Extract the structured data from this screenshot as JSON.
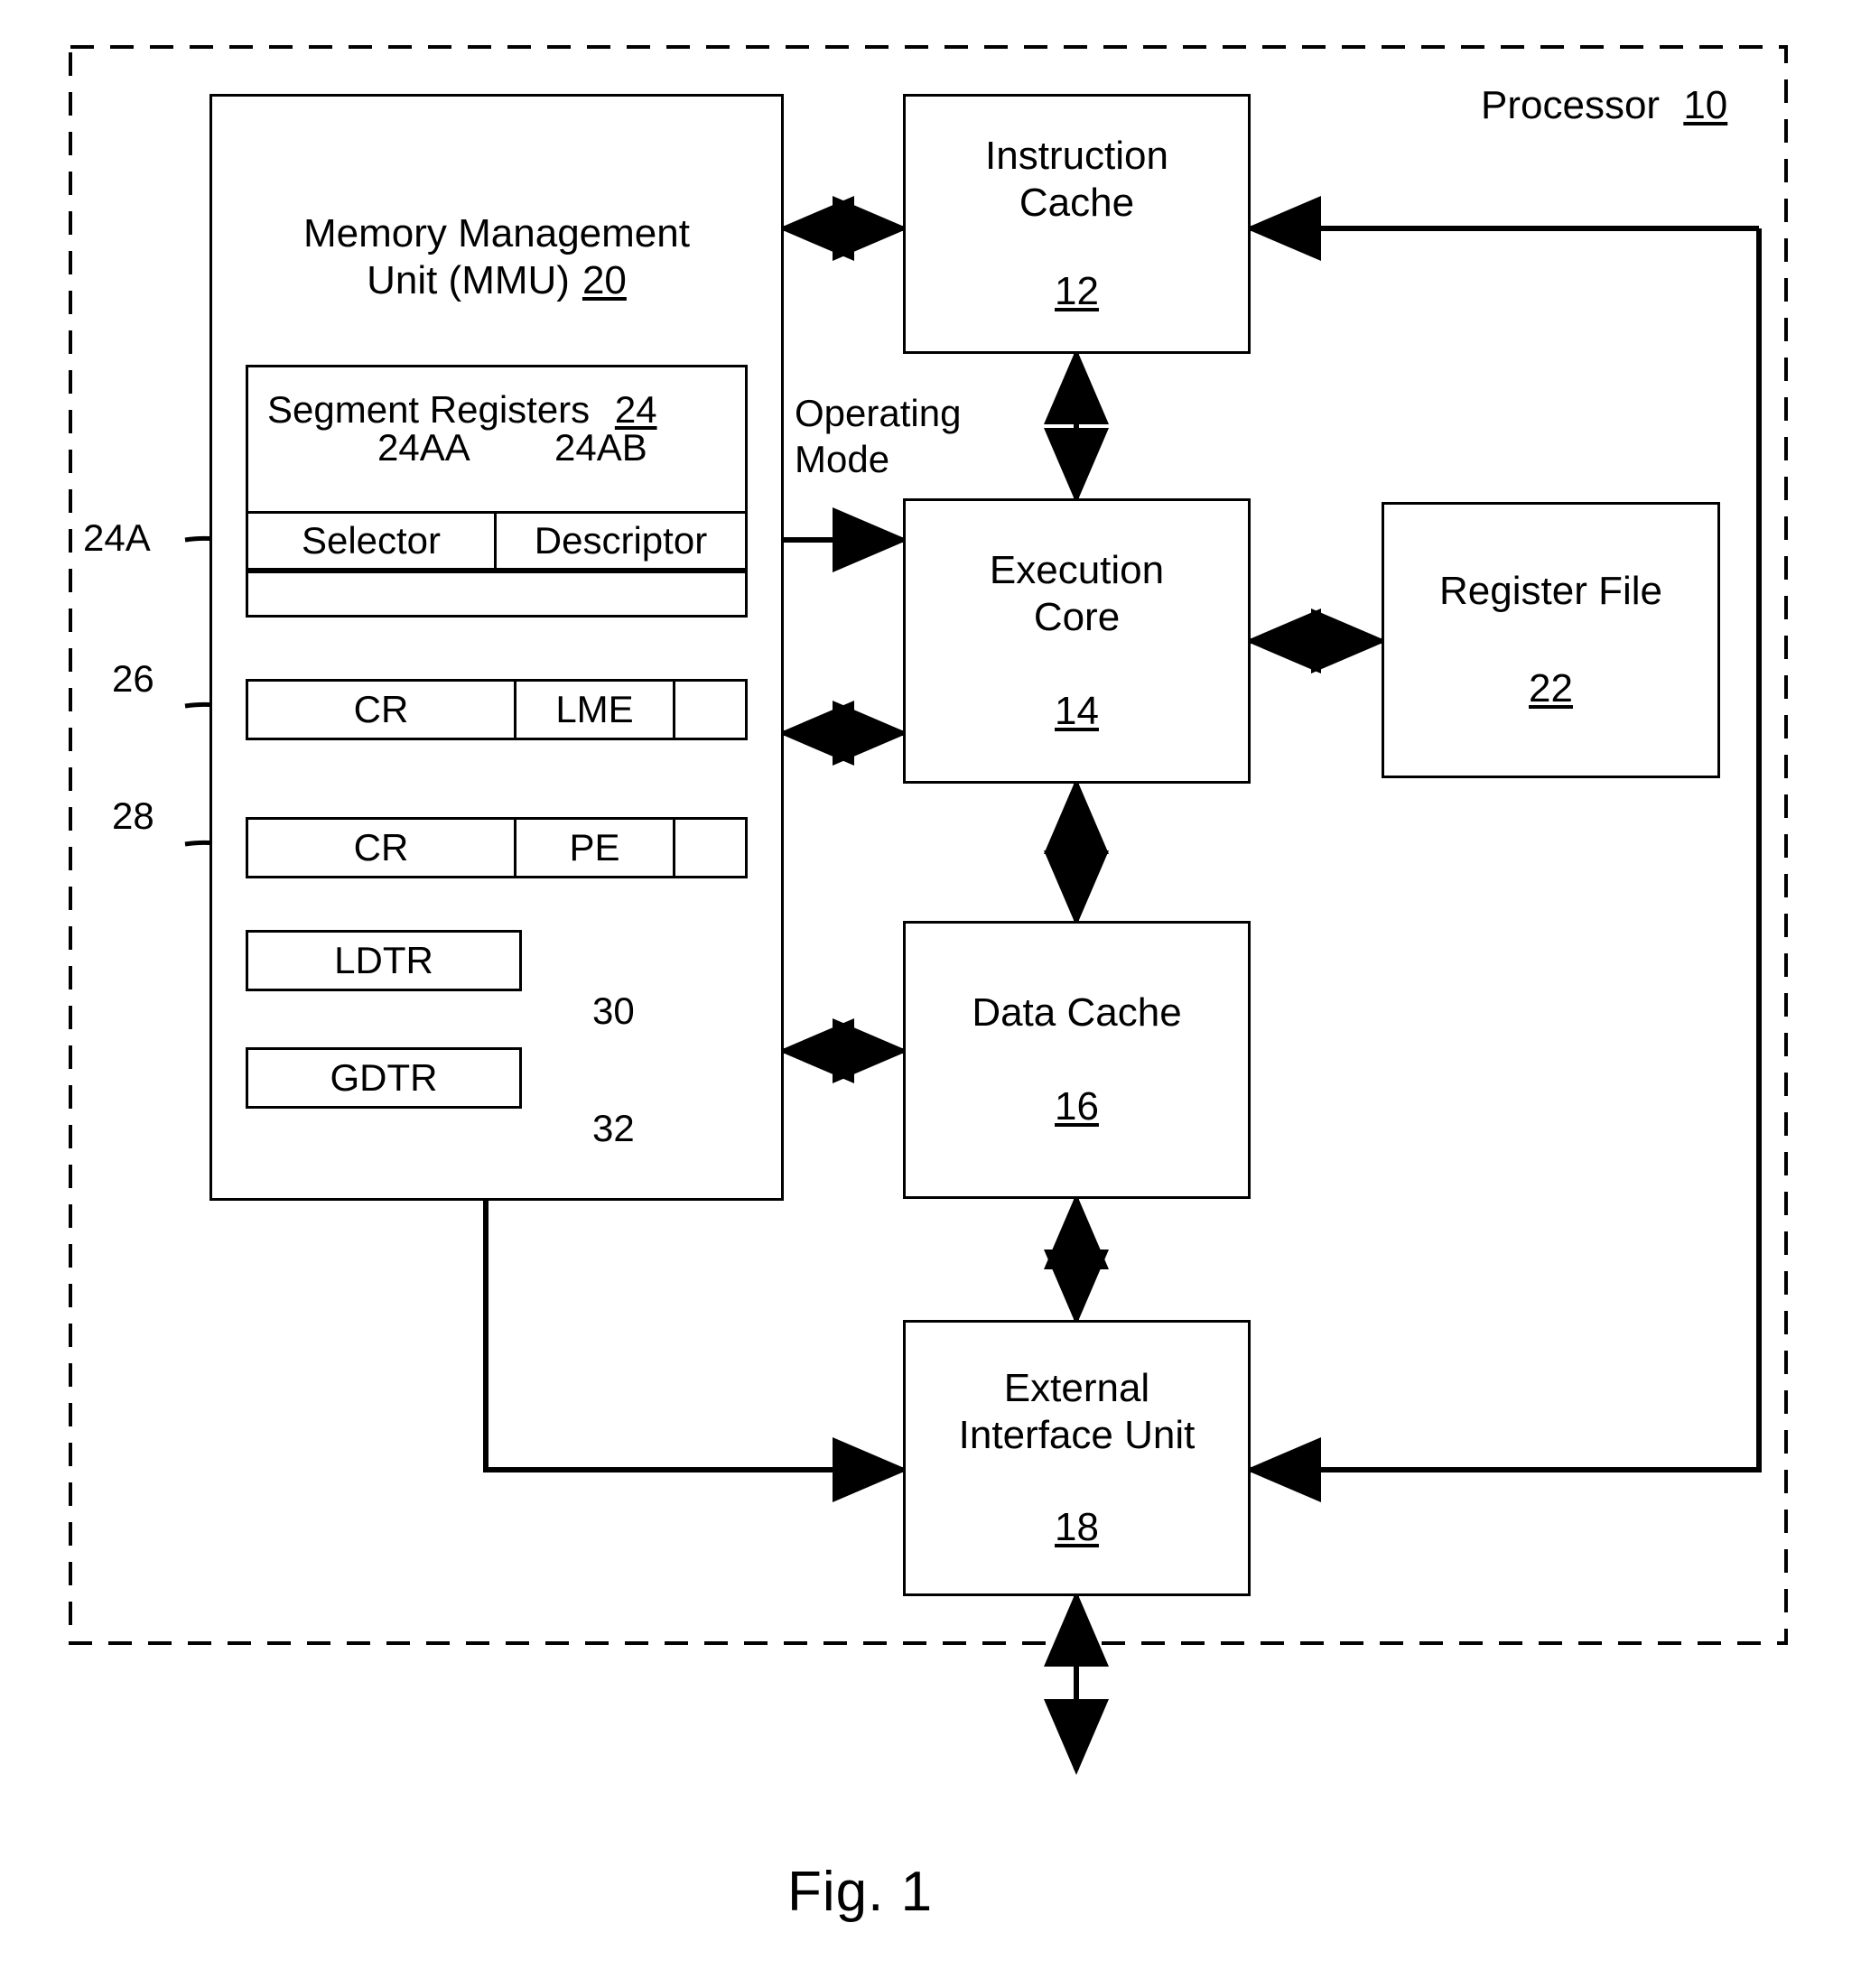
{
  "figure": {
    "caption": "Fig. 1",
    "outer_label": "Processor",
    "outer_ref": "10"
  },
  "blocks": {
    "mmu": {
      "title_line1": "Memory Management",
      "title_line2": "Unit (MMU)",
      "ref": "20"
    },
    "instruction_cache": {
      "line1": "Instruction",
      "line2": "Cache",
      "ref": "12"
    },
    "execution_core": {
      "line1": "Execution",
      "line2": "Core",
      "ref": "14"
    },
    "register_file": {
      "line1": "Register File",
      "ref": "22"
    },
    "data_cache": {
      "line1": "Data Cache",
      "ref": "16"
    },
    "external_interface_unit": {
      "line1": "External",
      "line2": "Interface Unit",
      "ref": "18"
    }
  },
  "segment_registers": {
    "title": "Segment Registers",
    "ref": "24",
    "callout_row": "24A",
    "callout_selector": "24AA",
    "callout_descriptor": "24AB",
    "cells": [
      "Selector",
      "Descriptor"
    ]
  },
  "control_registers": [
    {
      "callout": "26",
      "cells": [
        "CR",
        "LME",
        ""
      ]
    },
    {
      "callout": "28",
      "cells": [
        "CR",
        "PE",
        ""
      ]
    }
  ],
  "descriptor_tables": [
    {
      "name": "LDTR",
      "callout": "30"
    },
    {
      "name": "GDTR",
      "callout": "32"
    }
  ],
  "signals": {
    "operating_mode_line1": "Operating",
    "operating_mode_line2": "Mode"
  },
  "colors": {
    "ink": "#000000",
    "paper": "#ffffff"
  }
}
